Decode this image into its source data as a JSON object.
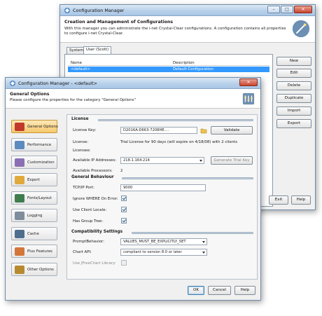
{
  "back_window": {
    "title": "Configuration Manager",
    "header_title": "Creation and Management of Configurations",
    "header_text_1": "With this manager you can administrate the i-net Crystal-Clear configurations. A configuration contains all properties",
    "header_text_2": "to configure i-net Crystal-Clear.",
    "tabs": [
      {
        "label": "System"
      },
      {
        "label": "User (Scott)"
      }
    ],
    "table": {
      "columns": [
        "Name",
        "Description"
      ],
      "rows": [
        {
          "name": "<default>",
          "description": "Default Configuration"
        }
      ]
    },
    "buttons": {
      "new": "New",
      "edit": "Edit",
      "delete": "Delete",
      "duplicate": "Duplicate",
      "import": "Import",
      "export": "Export",
      "exit": "Exit",
      "help": "Help"
    }
  },
  "front_window": {
    "title": "Configuration Manager - <default>",
    "header_title": "General Options",
    "header_text": "Please configure the properties for the category \"General Options\"",
    "categories": [
      {
        "label": "General Options",
        "icon": "general-options-icon",
        "active": true
      },
      {
        "label": "Performance",
        "icon": "performance-icon",
        "active": false
      },
      {
        "label": "Customization",
        "icon": "customization-icon",
        "active": false
      },
      {
        "label": "Export",
        "icon": "export-icon",
        "active": false
      },
      {
        "label": "Fonts/Layout",
        "icon": "fonts-layout-icon",
        "active": false
      },
      {
        "label": "Logging",
        "icon": "logging-icon",
        "active": false
      },
      {
        "label": "Cache",
        "icon": "cache-icon",
        "active": false
      },
      {
        "label": "Plus Features",
        "icon": "plus-features-icon",
        "active": false
      },
      {
        "label": "Other Options",
        "icon": "other-options-icon",
        "active": false
      }
    ],
    "license": {
      "section": "License",
      "key_label": "License Key:",
      "key_value": "D2016A-D663-7208HE....",
      "validate_button": "Validate",
      "license_label": "License:",
      "license_value": "Trial License for 90 days (will expire on 4/18/08) with 2 clients",
      "licensee_label": "Licensee:",
      "ip_label": "Available IP Addresses:",
      "ip_value": "218.1.164.214",
      "generate_button": "Generate Trial Key",
      "processors_label": "Available Processors:",
      "processors_value": "2"
    },
    "general_behaviour": {
      "section": "General Behaviour",
      "port_label": "TCP/IP Port:",
      "port_value": "9000",
      "ignore_where_label": "Ignore WHERE On Error:",
      "client_locale_label": "Use Client Locale:",
      "group_tree_label": "Has Group Tree:"
    },
    "compatibility": {
      "section": "Compatibility Settings",
      "prompt_label": "PromptBehavior:",
      "prompt_value": "VALUES_MUST_BE_EXPLICITLY_SET",
      "chart_api_label": "Chart API:",
      "chart_api_value": "compliant to version 8.0 or later",
      "jfreechart_label": "Use JFreeChart Library:"
    },
    "buttons": {
      "ok": "OK",
      "cancel": "Cancel",
      "help": "Help"
    }
  },
  "colors": {
    "selection": "#3399ff",
    "active_category": "#f6c86e"
  }
}
